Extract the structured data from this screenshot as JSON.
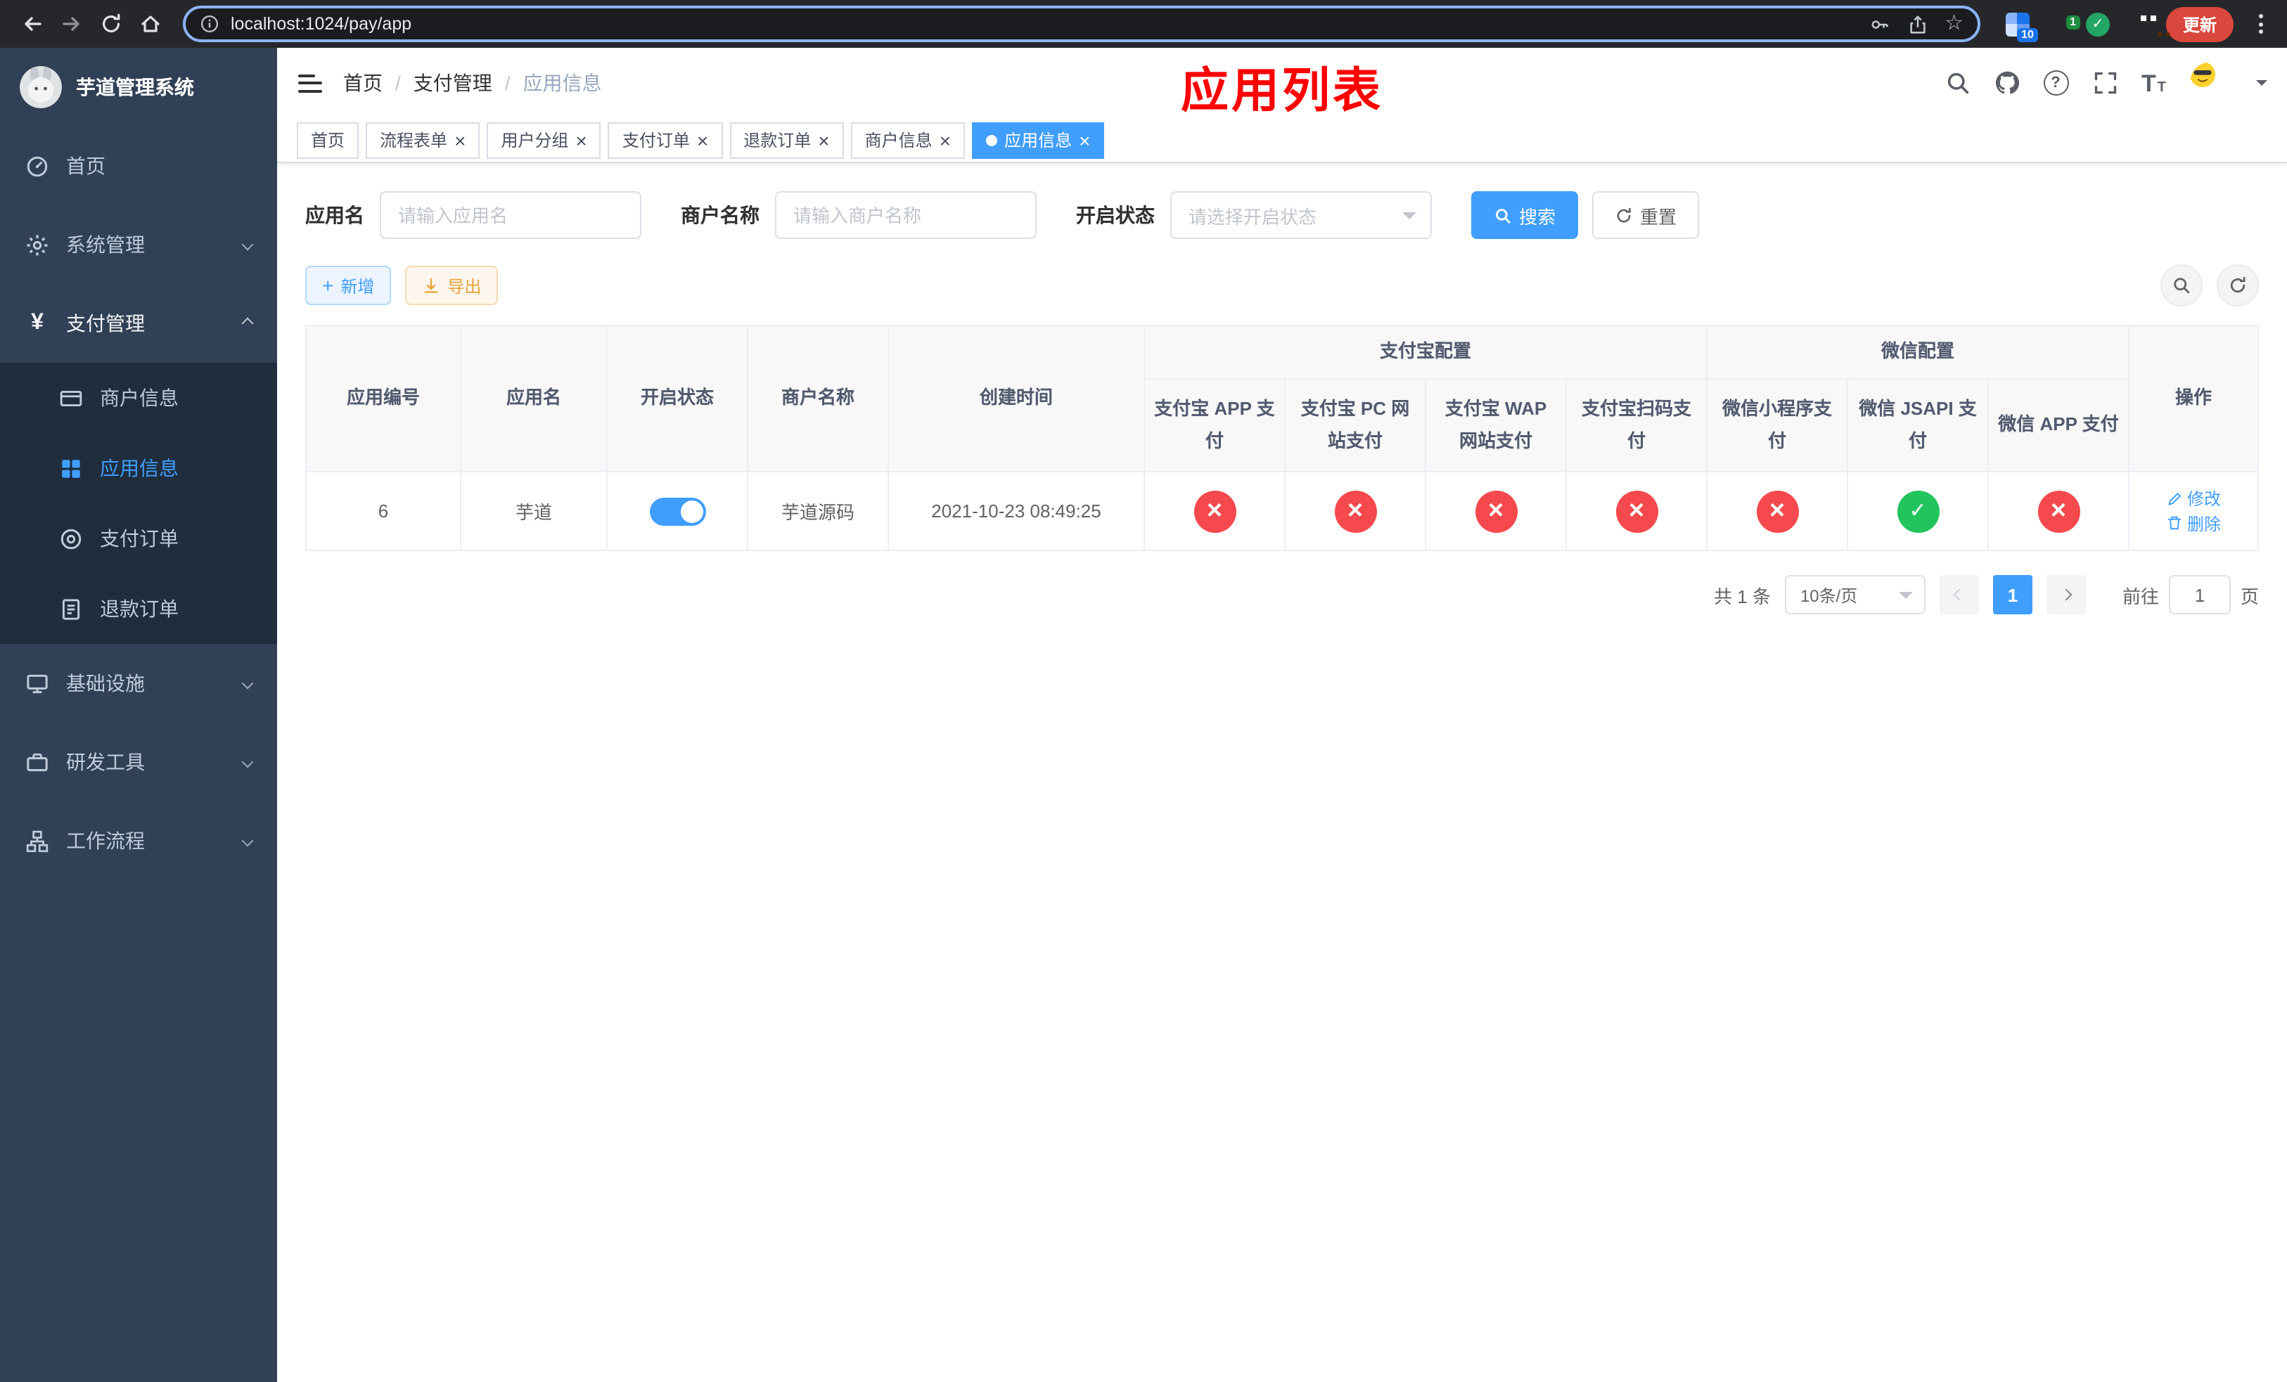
{
  "browser": {
    "url": "localhost:1024/pay/app",
    "update_label": "更新",
    "ext_badge_grid": "10",
    "ext_badge_avatar": "1"
  },
  "sidebar": {
    "logo_title": "芋道管理系统",
    "items": [
      {
        "label": "首页"
      },
      {
        "label": "系统管理"
      },
      {
        "label": "支付管理"
      },
      {
        "label": "基础设施"
      },
      {
        "label": "研发工具"
      },
      {
        "label": "工作流程"
      }
    ],
    "submenu": [
      {
        "label": "商户信息"
      },
      {
        "label": "应用信息"
      },
      {
        "label": "支付订单"
      },
      {
        "label": "退款订单"
      }
    ]
  },
  "navbar": {
    "breadcrumb": [
      "首页",
      "支付管理",
      "应用信息"
    ],
    "title": "应用列表"
  },
  "tabs": [
    {
      "label": "首页"
    },
    {
      "label": "流程表单"
    },
    {
      "label": "用户分组"
    },
    {
      "label": "支付订单"
    },
    {
      "label": "退款订单"
    },
    {
      "label": "商户信息"
    },
    {
      "label": "应用信息"
    }
  ],
  "filters": {
    "name_label": "应用名",
    "name_placeholder": "请输入应用名",
    "merchant_label": "商户名称",
    "merchant_placeholder": "请输入商户名称",
    "status_label": "开启状态",
    "status_placeholder": "请选择开启状态",
    "search": "搜索",
    "reset": "重置"
  },
  "toolbar": {
    "add": "新增",
    "export": "导出"
  },
  "table": {
    "main_columns": [
      "应用编号",
      "应用名",
      "开启状态",
      "商户名称",
      "创建时间"
    ],
    "alipay_group": "支付宝配置",
    "wechat_group": "微信配置",
    "alipay_columns": [
      "支付宝 APP 支付",
      "支付宝 PC 网站支付",
      "支付宝 WAP 网站支付",
      "支付宝扫码支付"
    ],
    "wechat_columns": [
      "微信小程序支付",
      "微信 JSAPI 支付",
      "微信 APP 支付"
    ],
    "op_column": "操作",
    "row": {
      "id": "6",
      "name": "芋道",
      "enabled": true,
      "merchant": "芋道源码",
      "created": "2021-10-23 08:49:25",
      "configs": [
        "no",
        "no",
        "no",
        "no",
        "no",
        "yes",
        "no"
      ],
      "edit": "修改",
      "delete": "删除"
    }
  },
  "pagination": {
    "total": "共 1 条",
    "page_size": "10条/页",
    "current_page": "1",
    "goto_label": "前往",
    "goto_value": "1",
    "goto_unit": "页"
  },
  "colors": {
    "primary": "#409EFF",
    "success": "#21c45d",
    "danger": "#f5494d",
    "warning": "#E6A23C",
    "title_red": "#FF0000",
    "sidebar_bg": "#304156",
    "submenu_bg": "#1f2d3d"
  }
}
